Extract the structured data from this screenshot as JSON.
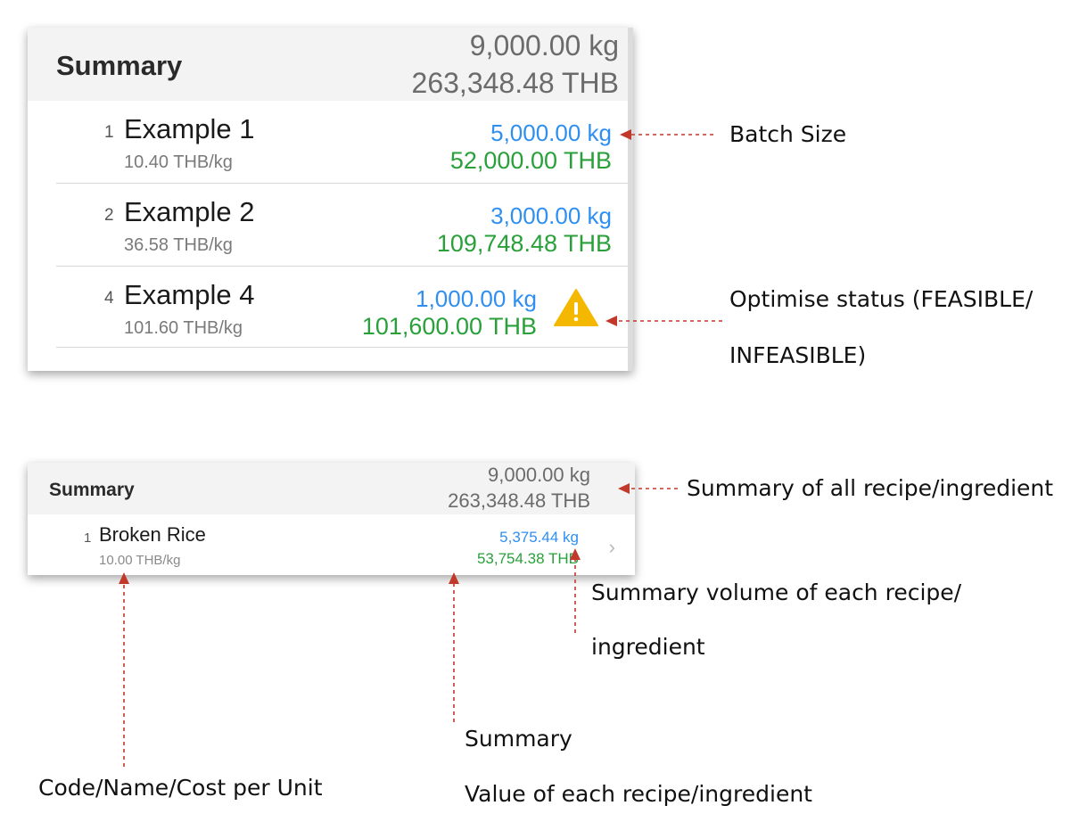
{
  "panel1": {
    "summary": {
      "title": "Summary",
      "amount": "9,000.00 kg",
      "cost": "263,348.48 THB"
    },
    "rows": [
      {
        "code": "1",
        "name": "Example 1",
        "unit_cost": "10.40 THB/kg",
        "amount": "5,000.00 kg",
        "value": "52,000.00 THB",
        "status_icon": ""
      },
      {
        "code": "2",
        "name": "Example 2",
        "unit_cost": "36.58 THB/kg",
        "amount": "3,000.00 kg",
        "value": "109,748.48 THB",
        "status_icon": ""
      },
      {
        "code": "4",
        "name": "Example 4",
        "unit_cost": "101.60 THB/kg",
        "amount": "1,000.00 kg",
        "value": "101,600.00 THB",
        "status_icon": "warning-icon"
      }
    ]
  },
  "panel2": {
    "summary": {
      "title": "Summary",
      "amount": "9,000.00 kg",
      "cost": "263,348.48 THB"
    },
    "rows": [
      {
        "code": "1",
        "name": "Broken Rice",
        "unit_cost": "10.00 THB/kg",
        "amount": "5,375.44 kg",
        "value": "53,754.38 THB",
        "chevron_icon": "chevron-right-icon"
      }
    ]
  },
  "annotations": {
    "batch_size": "Batch Size",
    "optimise_status_line1": "Optimise status (FEASIBLE/",
    "optimise_status_line2": "INFEASIBLE)",
    "summary_all": "Summary of all recipe/ingredient",
    "summary_volume_line1": "Summary volume of each recipe/",
    "summary_volume_line2": "ingredient",
    "summary_value_line1": "Summary",
    "summary_value_line2": "Value of each recipe/ingredient",
    "code_name_cost": "Code/Name/Cost per Unit"
  },
  "colors": {
    "amount": "#2f8ff0",
    "value": "#2aa03a",
    "warning": "#f5b800",
    "arrow": "#c0392b"
  }
}
